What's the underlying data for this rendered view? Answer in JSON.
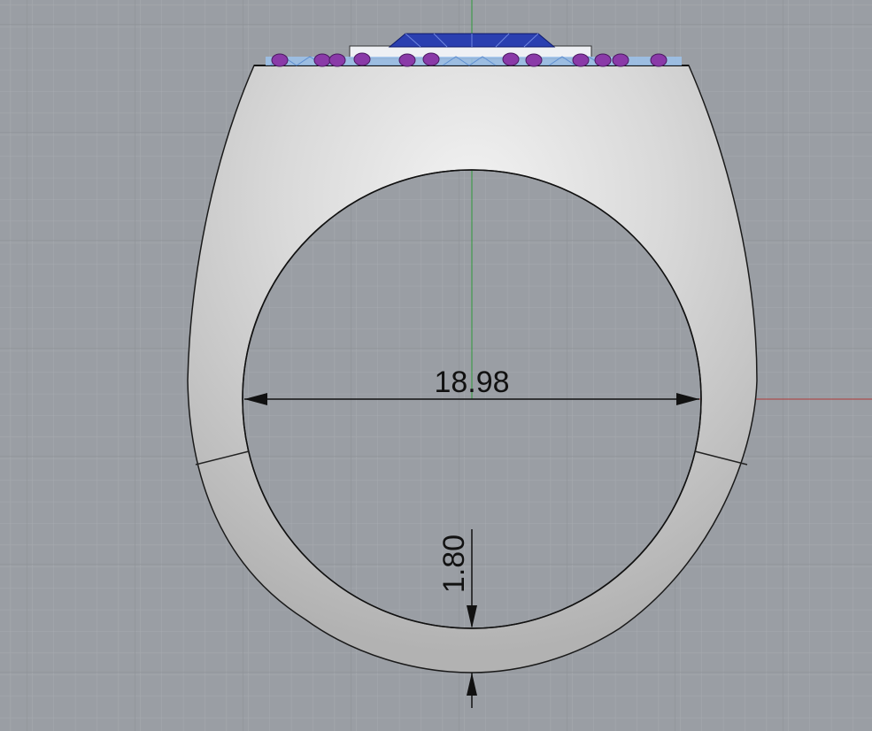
{
  "viewport": {
    "view": "front",
    "background_color": "#9a9ea4",
    "grid_minor_color": "#a6aaaf",
    "grid_major_color": "#8c9095",
    "x_axis_color": "#b03a3a",
    "y_axis_color": "#2e9a3a"
  },
  "model": {
    "ring_color": "#d8d8d8",
    "center_stone_color": "#2a3fb0",
    "accent_stone_color": "#8a3aa8",
    "pave_stone_color": "#8fb8e6"
  },
  "dimensions": {
    "inner_diameter": "18.98",
    "shank_thickness": "1.80"
  }
}
